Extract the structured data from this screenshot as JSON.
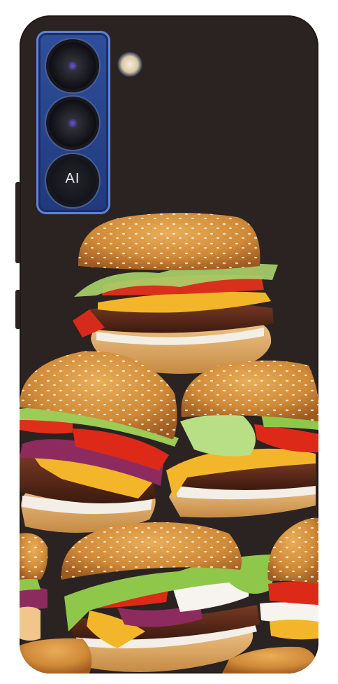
{
  "product": {
    "camera_label": "AI"
  },
  "colors": {
    "case": "#2b2321",
    "camera_module": "#2a4a96",
    "bun": "#d3903f",
    "patty": "#5a2a1c",
    "cheese": "#f3b62a",
    "tomato": "#e02a18",
    "lettuce": "#8fc74a",
    "onion": "#a0306a"
  },
  "icons": [
    "camera-lens-icon",
    "flash-icon"
  ]
}
